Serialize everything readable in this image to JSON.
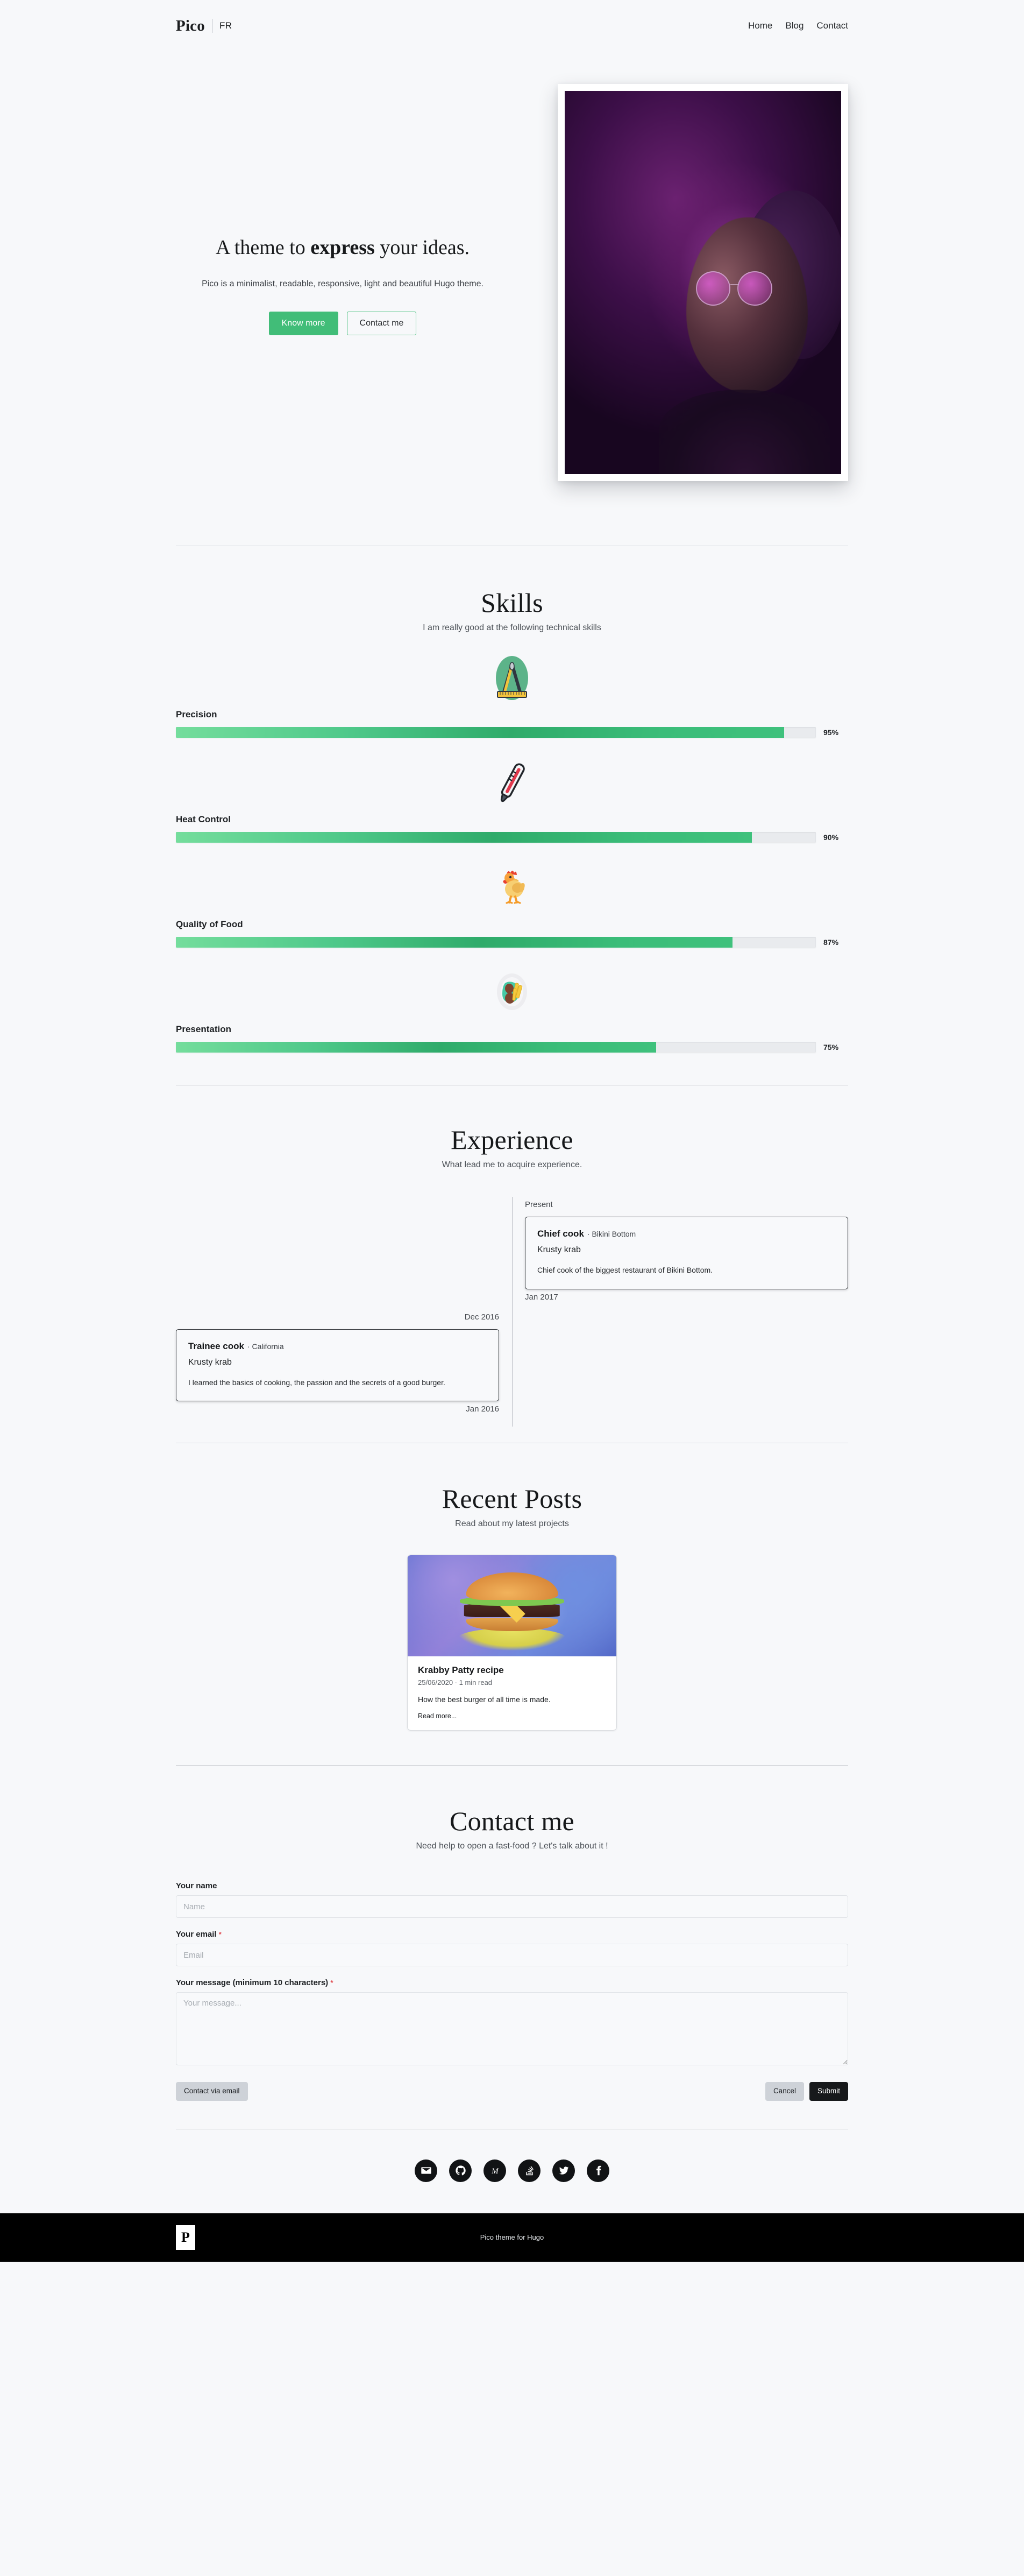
{
  "header": {
    "brand": "Pico",
    "lang_toggle": "FR",
    "nav": [
      {
        "label": "Home"
      },
      {
        "label": "Blog"
      },
      {
        "label": "Contact"
      }
    ]
  },
  "hero": {
    "title_pre": "A theme to ",
    "title_strong": "express",
    "title_post": " your ideas.",
    "subtitle": "Pico is a minimalist, readable, responsive, light and beautiful Hugo theme.",
    "primary_button": "Know more",
    "secondary_button": "Contact me",
    "image_alt": "portrait-photo"
  },
  "skills": {
    "title": "Skills",
    "subtitle": "I am really good at the following technical skills",
    "items": [
      {
        "icon": "compass-icon",
        "label": "Precision",
        "value": 95,
        "pct": "95%"
      },
      {
        "icon": "thermometer-icon",
        "label": "Heat Control",
        "value": 90,
        "pct": "90%"
      },
      {
        "icon": "chicken-icon",
        "label": "Quality of Food",
        "value": 87,
        "pct": "87%"
      },
      {
        "icon": "plate-icon",
        "label": "Presentation",
        "value": 75,
        "pct": "75%"
      }
    ]
  },
  "experience": {
    "title": "Experience",
    "subtitle": "What lead me to acquire experience.",
    "entries": [
      {
        "side": "right",
        "date_top": "Present",
        "date_bottom": "Jan 2017",
        "role": "Chief cook",
        "location": "· Bikini Bottom",
        "company": "Krusty krab",
        "description": "Chief cook of the biggest restaurant of Bikini Bottom."
      },
      {
        "side": "left",
        "date_top": "Dec 2016",
        "date_bottom": "Jan 2016",
        "role": "Trainee cook",
        "location": "· California",
        "company": "Krusty krab",
        "description": "I learned the basics of cooking, the passion and the secrets of a good burger."
      }
    ]
  },
  "posts": {
    "title": "Recent Posts",
    "subtitle": "Read about my latest projects",
    "items": [
      {
        "title": "Krabby Patty recipe",
        "meta": "25/06/2020 · 1 min read",
        "excerpt": "How the best burger of all time is made.",
        "read_more": "Read more..."
      }
    ]
  },
  "contact": {
    "title": "Contact me",
    "subtitle": "Need help to open a fast-food ? Let's talk about it !",
    "name_label": "Your name",
    "name_placeholder": "Name",
    "email_label": "Your email",
    "email_required": "*",
    "email_placeholder": "Email",
    "message_label": "Your message (minimum 10 characters)",
    "message_required": "*",
    "message_placeholder": "Your message...",
    "email_button": "Contact via email",
    "cancel_button": "Cancel",
    "submit_button": "Submit"
  },
  "social": [
    {
      "name": "email-icon"
    },
    {
      "name": "github-icon"
    },
    {
      "name": "medium-icon"
    },
    {
      "name": "stackoverflow-icon"
    },
    {
      "name": "twitter-icon"
    },
    {
      "name": "facebook-icon"
    }
  ],
  "footer": {
    "logo_letter": "P",
    "credit": "Pico theme for Hugo"
  },
  "colors": {
    "accent_green": "#41bd78",
    "bar_start": "#74dd9c",
    "bar_end": "#2fab6a",
    "background": "#f7f8fa",
    "footer_bg": "#000000",
    "required_red": "#e0474c"
  }
}
